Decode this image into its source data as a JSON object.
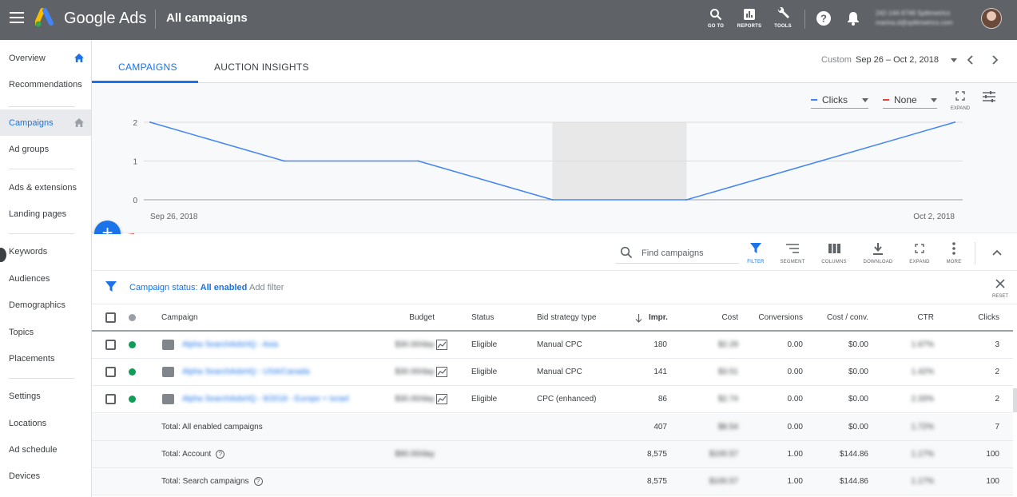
{
  "topbar": {
    "brand": "Google Ads",
    "page_title": "All campaigns",
    "buttons": [
      {
        "id": "goto",
        "label": "GO TO",
        "icon": "search-icon"
      },
      {
        "id": "reports",
        "label": "REPORTS",
        "icon": "reports-icon"
      },
      {
        "id": "tools",
        "label": "TOOLS",
        "icon": "wrench-icon"
      }
    ],
    "account_line1": "242-144-9748 Splitmetrics",
    "account_line2": "marina.d@splitmetrics.com"
  },
  "sidebar": {
    "items": [
      {
        "label": "Overview",
        "home": true,
        "active": false
      },
      {
        "label": "Recommendations",
        "home": false,
        "active": false
      },
      {
        "label": "Campaigns",
        "home": true,
        "active": true
      },
      {
        "label": "Ad groups",
        "home": false,
        "active": false
      },
      {
        "label": "Ads & extensions",
        "home": false,
        "active": false
      },
      {
        "label": "Landing pages",
        "home": false,
        "active": false
      },
      {
        "label": "Keywords",
        "home": false,
        "active": false
      },
      {
        "label": "Audiences",
        "home": false,
        "active": false
      },
      {
        "label": "Demographics",
        "home": false,
        "active": false
      },
      {
        "label": "Topics",
        "home": false,
        "active": false
      },
      {
        "label": "Placements",
        "home": false,
        "active": false
      },
      {
        "label": "Settings",
        "home": false,
        "active": false
      },
      {
        "label": "Locations",
        "home": false,
        "active": false
      },
      {
        "label": "Ad schedule",
        "home": false,
        "active": false
      },
      {
        "label": "Devices",
        "home": false,
        "active": false
      }
    ]
  },
  "tabs": [
    {
      "label": "CAMPAIGNS",
      "active": true
    },
    {
      "label": "AUCTION INSIGHTS",
      "active": false
    }
  ],
  "date_range": {
    "custom_label": "Custom",
    "value": "Sep 26 – Oct 2, 2018"
  },
  "chart_controls": {
    "metric1": "Clicks",
    "metric2": "None",
    "expand_label": "EXPAND",
    "colors": {
      "metric1": "#4285f4",
      "metric2": "#ea4335"
    }
  },
  "chart_data": {
    "type": "line",
    "x": [
      "Sep 26, 2018",
      "Sep 27, 2018",
      "Sep 28, 2018",
      "Sep 29, 2018",
      "Sep 30, 2018",
      "Oct 1, 2018",
      "Oct 2, 2018"
    ],
    "x_tick_labels": [
      "Sep 26, 2018",
      "Oct 2, 2018"
    ],
    "series": [
      {
        "name": "Clicks",
        "values": [
          2,
          1,
          1,
          0,
          0,
          1,
          2
        ],
        "color": "#4285f4"
      }
    ],
    "yticks": [
      0,
      1,
      2
    ],
    "ylim": [
      0,
      2
    ],
    "grid": true,
    "shaded_range": [
      "Sep 29, 2018",
      "Sep 30, 2018"
    ]
  },
  "toolbar": {
    "search_placeholder": "Find campaigns",
    "buttons": [
      {
        "label": "FILTER",
        "icon": "filter-icon",
        "active": true
      },
      {
        "label": "SEGMENT",
        "icon": "segment-icon",
        "active": false
      },
      {
        "label": "COLUMNS",
        "icon": "columns-icon",
        "active": false
      },
      {
        "label": "DOWNLOAD",
        "icon": "download-icon",
        "active": false
      },
      {
        "label": "EXPAND",
        "icon": "expand-icon",
        "active": false
      },
      {
        "label": "MORE",
        "icon": "more-icon",
        "active": false
      }
    ]
  },
  "filter": {
    "prefix": "Campaign status: ",
    "value": "All enabled",
    "add_label": "Add filter",
    "reset_label": "RESET"
  },
  "table": {
    "headers": {
      "campaign": "Campaign",
      "budget": "Budget",
      "status": "Status",
      "bid": "Bid strategy type",
      "impr": "Impr.",
      "cost": "Cost",
      "conversions": "Conversions",
      "cost_conv": "Cost / conv.",
      "ctr": "CTR",
      "clicks": "Clicks"
    },
    "rows": [
      {
        "campaign": "Alpha SearchAdsHQ - Asia",
        "budget": "$30.00/day",
        "status": "Eligible",
        "bid": "Manual CPC",
        "impr": "180",
        "cost": "$2.29",
        "conversions": "0.00",
        "cost_conv": "$0.00",
        "ctr": "1.67%",
        "clicks": "3"
      },
      {
        "campaign": "Alpha SearchAdsHQ - USA/Canada",
        "budget": "$30.00/day",
        "status": "Eligible",
        "bid": "Manual CPC",
        "impr": "141",
        "cost": "$3.51",
        "conversions": "0.00",
        "cost_conv": "$0.00",
        "ctr": "1.42%",
        "clicks": "2"
      },
      {
        "campaign": "Alpha SearchAdsHQ - 9/2018 - Europe + Israel",
        "budget": "$30.00/day",
        "status": "Eligible",
        "bid": "CPC (enhanced)",
        "impr": "86",
        "cost": "$2.74",
        "conversions": "0.00",
        "cost_conv": "$0.00",
        "ctr": "2.33%",
        "clicks": "2"
      }
    ],
    "totals": [
      {
        "label": "Total: All enabled campaigns",
        "help": false,
        "budget": "",
        "impr": "407",
        "cost": "$8.54",
        "conversions": "0.00",
        "cost_conv": "$0.00",
        "ctr": "1.72%",
        "clicks": "7"
      },
      {
        "label": "Total: Account",
        "help": true,
        "budget": "$90.00/day",
        "impr": "8,575",
        "cost": "$100.57",
        "conversions": "1.00",
        "cost_conv": "$144.86",
        "ctr": "1.17%",
        "clicks": "100"
      },
      {
        "label": "Total: Search campaigns",
        "help": true,
        "budget": "",
        "impr": "8,575",
        "cost": "$100.57",
        "conversions": "1.00",
        "cost_conv": "$144.86",
        "ctr": "1.17%",
        "clicks": "100"
      }
    ]
  }
}
